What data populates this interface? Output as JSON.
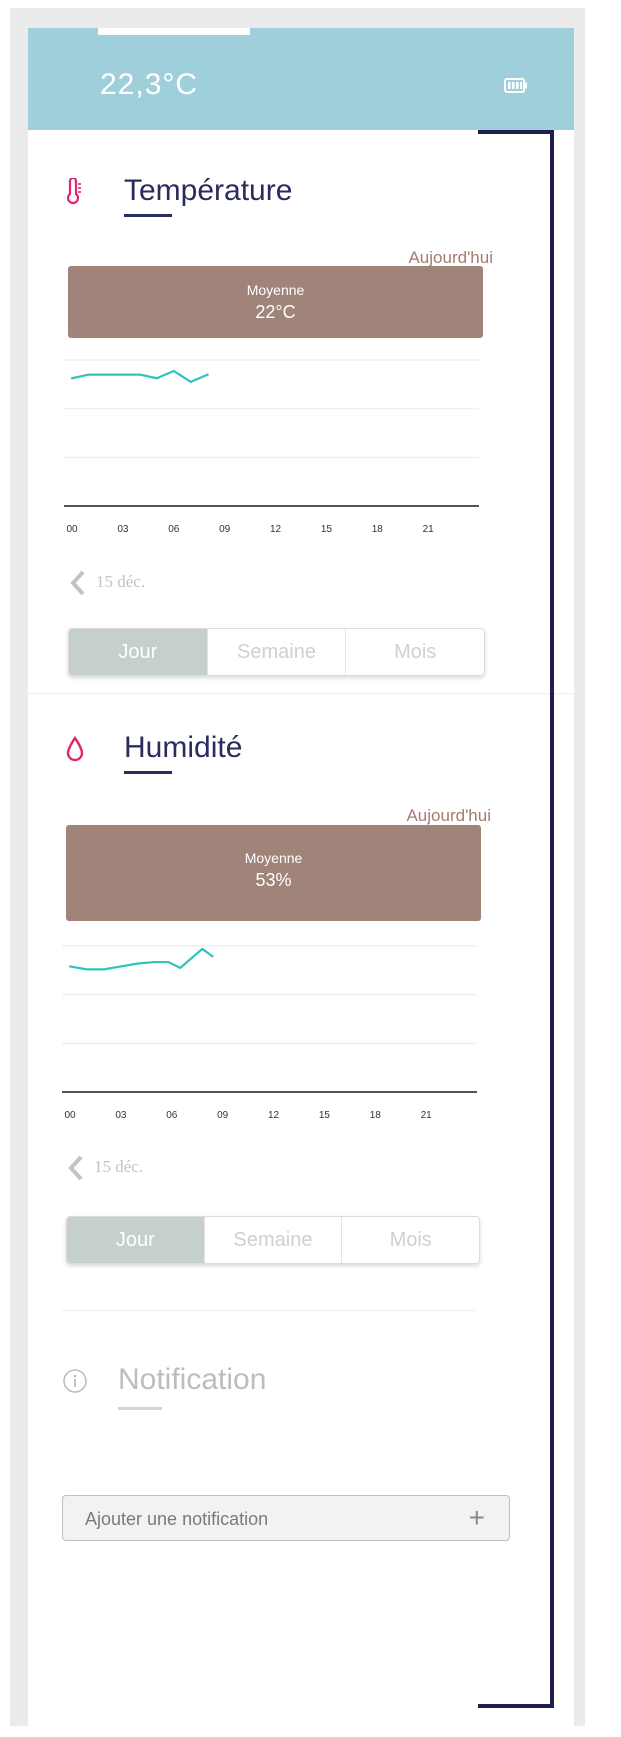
{
  "status_bar": {
    "temperature": "22,3°C",
    "battery_icon": "battery-icon"
  },
  "temperature": {
    "title": "Température",
    "icon": "thermometer-icon",
    "period_label": "Aujourd'hui",
    "average_label": "Moyenne",
    "average_value": "22°C",
    "date": "15 déc.",
    "segments": [
      "Jour",
      "Semaine",
      "Mois"
    ],
    "selected_segment": "Jour"
  },
  "humidity": {
    "title": "Humidité",
    "icon": "droplet-icon",
    "period_label": "Aujourd'hui",
    "average_label": "Moyenne",
    "average_value": "53%",
    "date": "15 déc.",
    "segments": [
      "Jour",
      "Semaine",
      "Mois"
    ],
    "selected_segment": "Jour"
  },
  "notification": {
    "title": "Notification",
    "icon": "info-icon",
    "add_label": "Ajouter une notification",
    "add_icon": "plus-icon"
  },
  "colors": {
    "header": "#9fcfdb",
    "average_box": "#a0847a",
    "line": "#33c1bc",
    "title": "#2b2c5e",
    "accent_pink": "#e0266e",
    "selected_segment": "#c6d0ca"
  },
  "chart_data": [
    {
      "type": "line",
      "x_ticks": [
        "00",
        "03",
        "06",
        "09",
        "12",
        "15",
        "18",
        "21"
      ],
      "x": [
        0,
        1,
        2,
        3,
        4,
        5,
        6,
        7,
        8
      ],
      "series": [
        {
          "values": [
            21.5,
            21.6,
            21.6,
            21.6,
            21.6,
            21.5,
            21.7,
            21.4,
            21.6
          ]
        }
      ],
      "xlim": [
        0,
        24
      ],
      "ylim": [
        18,
        22
      ],
      "grid": true
    },
    {
      "type": "line",
      "x_ticks": [
        "00",
        "03",
        "06",
        "09",
        "12",
        "15",
        "18",
        "21"
      ],
      "x": [
        0,
        1,
        2,
        3,
        4,
        5,
        5.8,
        6.5,
        7.1,
        7.8,
        8.4
      ],
      "series": [
        {
          "values": [
            52.6,
            52.4,
            52.4,
            52.6,
            52.8,
            52.9,
            52.9,
            52.5,
            53.1,
            53.8,
            53.3
          ]
        }
      ],
      "xlim": [
        0,
        24
      ],
      "ylim": [
        44,
        54
      ],
      "grid": true
    }
  ]
}
